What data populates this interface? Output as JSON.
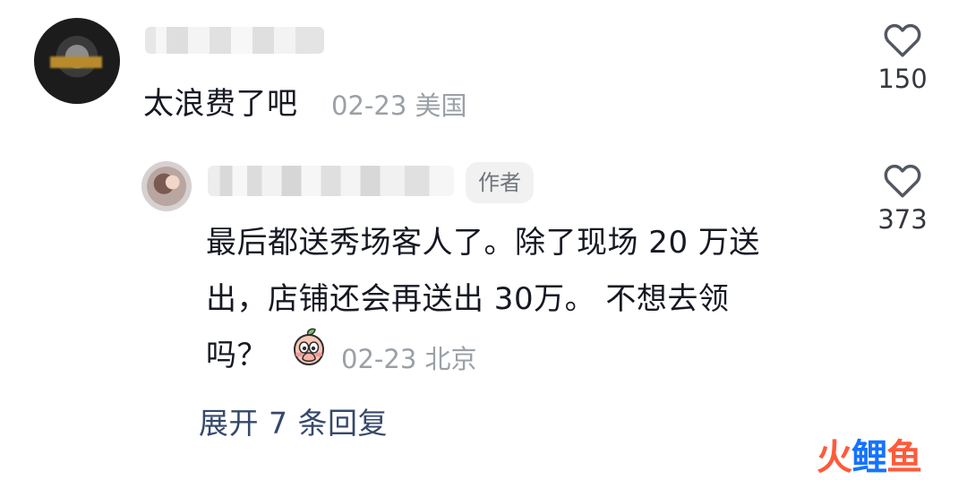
{
  "comments": {
    "main": {
      "text": "太浪费了吧",
      "date": "02-23",
      "location": "美国",
      "likes": "150"
    },
    "reply": {
      "author_badge": "作者",
      "lines": [
        "最后都送秀场客人了。除了现场 20 万送",
        "出，店铺还会再送出 30万。 不想去领",
        "吗？"
      ],
      "date": "02-23",
      "location": "北京",
      "likes": "373"
    },
    "expand_label": "展开 7 条回复"
  },
  "watermark": {
    "part1": "火",
    "part2": "鲤",
    "part3": "鱼"
  },
  "icons": {
    "like": "heart-outline-icon",
    "emoji": "peach-emoji-icon"
  },
  "colors": {
    "meta": "#9aa0a6",
    "link": "#36486b",
    "badge_bg": "#f1f1f2"
  }
}
